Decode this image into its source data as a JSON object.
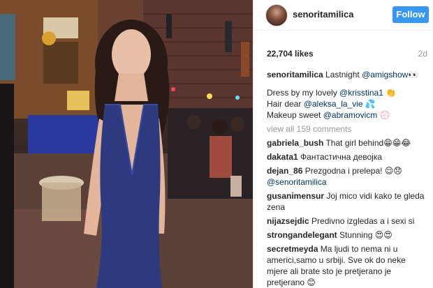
{
  "post": {
    "username": "senoritamilica",
    "follow_label": "Follow",
    "likes": "22,704 likes",
    "age": "2d"
  },
  "caption": {
    "username": "senoritamilica",
    "line1_text": " Lastnight ",
    "line1_mention": "@amigshow",
    "line1_emoji": "👀",
    "line2_text": "Dress by my lovely ",
    "line2_mention": "@krisstina1",
    "line2_emoji": " 👏",
    "line3_text": "Hair dear ",
    "line3_mention": "@aleksa_la_vie",
    "line3_emoji": " 💦",
    "line4_text": "Makeup sweet ",
    "line4_mention": "@abramovicm",
    "line4_emoji": " 💮"
  },
  "view_all": "view all 159 comments",
  "comments": [
    {
      "user": "gabriela_bush",
      "text": " That girl behind😁😁😂"
    },
    {
      "user": "dakata1",
      "text": " Фантастична девојка"
    },
    {
      "user": "dejan_86",
      "text": " Prezgodna i prelepa! 😌😞",
      "mention": "@senoritamilica"
    },
    {
      "user": "gusanimensur",
      "text": " Joj mico vidi kako te gleda zena"
    },
    {
      "user": "nijazsejdic",
      "text": " Predivno izgledas a i sexi si"
    },
    {
      "user": "strongandelegant",
      "text": " Stunning 😍😍"
    },
    {
      "user": "secretmeyda",
      "text": " Ma ljudi to nema ni u americi,samo u srbiji. Sve ok do neke mjere ali brate sto je pretjerano je pretjerano 😊"
    }
  ]
}
